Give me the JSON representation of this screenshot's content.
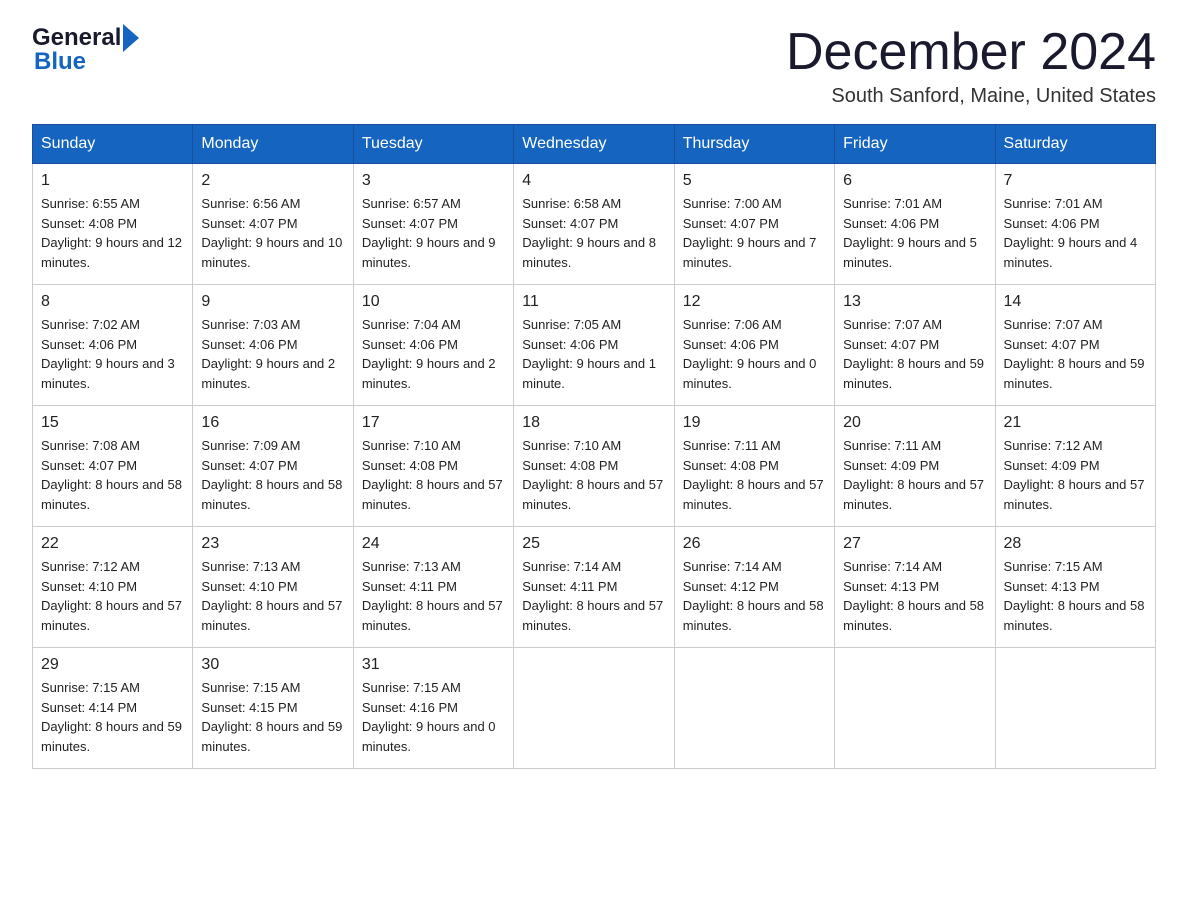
{
  "header": {
    "logo_general": "General",
    "logo_blue": "Blue",
    "month_title": "December 2024",
    "location": "South Sanford, Maine, United States"
  },
  "days_of_week": [
    "Sunday",
    "Monday",
    "Tuesday",
    "Wednesday",
    "Thursday",
    "Friday",
    "Saturday"
  ],
  "weeks": [
    [
      {
        "day": "1",
        "sunrise": "6:55 AM",
        "sunset": "4:08 PM",
        "daylight": "9 hours and 12 minutes."
      },
      {
        "day": "2",
        "sunrise": "6:56 AM",
        "sunset": "4:07 PM",
        "daylight": "9 hours and 10 minutes."
      },
      {
        "day": "3",
        "sunrise": "6:57 AM",
        "sunset": "4:07 PM",
        "daylight": "9 hours and 9 minutes."
      },
      {
        "day": "4",
        "sunrise": "6:58 AM",
        "sunset": "4:07 PM",
        "daylight": "9 hours and 8 minutes."
      },
      {
        "day": "5",
        "sunrise": "7:00 AM",
        "sunset": "4:07 PM",
        "daylight": "9 hours and 7 minutes."
      },
      {
        "day": "6",
        "sunrise": "7:01 AM",
        "sunset": "4:06 PM",
        "daylight": "9 hours and 5 minutes."
      },
      {
        "day": "7",
        "sunrise": "7:01 AM",
        "sunset": "4:06 PM",
        "daylight": "9 hours and 4 minutes."
      }
    ],
    [
      {
        "day": "8",
        "sunrise": "7:02 AM",
        "sunset": "4:06 PM",
        "daylight": "9 hours and 3 minutes."
      },
      {
        "day": "9",
        "sunrise": "7:03 AM",
        "sunset": "4:06 PM",
        "daylight": "9 hours and 2 minutes."
      },
      {
        "day": "10",
        "sunrise": "7:04 AM",
        "sunset": "4:06 PM",
        "daylight": "9 hours and 2 minutes."
      },
      {
        "day": "11",
        "sunrise": "7:05 AM",
        "sunset": "4:06 PM",
        "daylight": "9 hours and 1 minute."
      },
      {
        "day": "12",
        "sunrise": "7:06 AM",
        "sunset": "4:06 PM",
        "daylight": "9 hours and 0 minutes."
      },
      {
        "day": "13",
        "sunrise": "7:07 AM",
        "sunset": "4:07 PM",
        "daylight": "8 hours and 59 minutes."
      },
      {
        "day": "14",
        "sunrise": "7:07 AM",
        "sunset": "4:07 PM",
        "daylight": "8 hours and 59 minutes."
      }
    ],
    [
      {
        "day": "15",
        "sunrise": "7:08 AM",
        "sunset": "4:07 PM",
        "daylight": "8 hours and 58 minutes."
      },
      {
        "day": "16",
        "sunrise": "7:09 AM",
        "sunset": "4:07 PM",
        "daylight": "8 hours and 58 minutes."
      },
      {
        "day": "17",
        "sunrise": "7:10 AM",
        "sunset": "4:08 PM",
        "daylight": "8 hours and 57 minutes."
      },
      {
        "day": "18",
        "sunrise": "7:10 AM",
        "sunset": "4:08 PM",
        "daylight": "8 hours and 57 minutes."
      },
      {
        "day": "19",
        "sunrise": "7:11 AM",
        "sunset": "4:08 PM",
        "daylight": "8 hours and 57 minutes."
      },
      {
        "day": "20",
        "sunrise": "7:11 AM",
        "sunset": "4:09 PM",
        "daylight": "8 hours and 57 minutes."
      },
      {
        "day": "21",
        "sunrise": "7:12 AM",
        "sunset": "4:09 PM",
        "daylight": "8 hours and 57 minutes."
      }
    ],
    [
      {
        "day": "22",
        "sunrise": "7:12 AM",
        "sunset": "4:10 PM",
        "daylight": "8 hours and 57 minutes."
      },
      {
        "day": "23",
        "sunrise": "7:13 AM",
        "sunset": "4:10 PM",
        "daylight": "8 hours and 57 minutes."
      },
      {
        "day": "24",
        "sunrise": "7:13 AM",
        "sunset": "4:11 PM",
        "daylight": "8 hours and 57 minutes."
      },
      {
        "day": "25",
        "sunrise": "7:14 AM",
        "sunset": "4:11 PM",
        "daylight": "8 hours and 57 minutes."
      },
      {
        "day": "26",
        "sunrise": "7:14 AM",
        "sunset": "4:12 PM",
        "daylight": "8 hours and 58 minutes."
      },
      {
        "day": "27",
        "sunrise": "7:14 AM",
        "sunset": "4:13 PM",
        "daylight": "8 hours and 58 minutes."
      },
      {
        "day": "28",
        "sunrise": "7:15 AM",
        "sunset": "4:13 PM",
        "daylight": "8 hours and 58 minutes."
      }
    ],
    [
      {
        "day": "29",
        "sunrise": "7:15 AM",
        "sunset": "4:14 PM",
        "daylight": "8 hours and 59 minutes."
      },
      {
        "day": "30",
        "sunrise": "7:15 AM",
        "sunset": "4:15 PM",
        "daylight": "8 hours and 59 minutes."
      },
      {
        "day": "31",
        "sunrise": "7:15 AM",
        "sunset": "4:16 PM",
        "daylight": "9 hours and 0 minutes."
      },
      null,
      null,
      null,
      null
    ]
  ],
  "labels": {
    "sunrise_prefix": "Sunrise: ",
    "sunset_prefix": "Sunset: ",
    "daylight_prefix": "Daylight: "
  }
}
